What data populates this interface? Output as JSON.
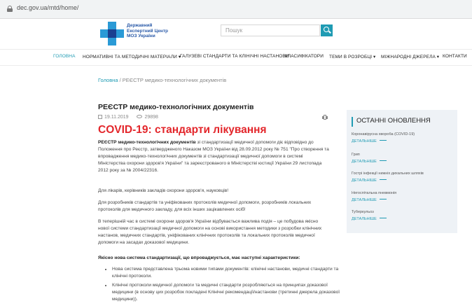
{
  "browser": {
    "url": "dec.gov.ua/mtd/home/"
  },
  "logo": {
    "text": "Державний Експертний Центр МОЗ України"
  },
  "search": {
    "placeholder": "Пошук"
  },
  "nav": {
    "items": [
      "ГОЛОВНА",
      "НОРМАТИВНІ ТА МЕТОДИЧНІ МАТЕРІАЛИ ▾",
      "ГАЛУЗЕВІ СТАНДАРТИ ТА КЛІНІЧНІ НАСТАНОВИ",
      "КЛАСИФІКАТОРИ",
      "ТЕМИ В РОЗРОБЦІ ▾",
      "МІЖНАРОДНІ ДЖЕРЕЛА ▾",
      "КОНТАКТИ"
    ]
  },
  "breadcrumb": {
    "home": "Головна",
    "separator": "/",
    "current": "РЕЄСТР медико-технологічних документів"
  },
  "page": {
    "title": "РЕЄСТР медико-технологічних документів",
    "date": "19.11.2019",
    "views": "29898",
    "headline": "COVID-19: стандарти лікування",
    "p1_bold": "РЕЄСТР медико-технологічних документів",
    "p1_rest": " зі стандартизації медичної допомоги діє відповідно до Положення про Реєстр, затвердженого Наказом МОЗ України від 28.09.2012 року № 751 \"Про створення та впровадження медико-технологічних документів зі стандартизації медичної допомоги в системі Міністерства охорони здоров'я України\" та зареєстрованого в Міністерстві юстиції України 29 листопада 2012 року за № 2004/22316.",
    "p2": "Для лікарів, керівників закладів охорони здоров'я, науковців!",
    "p3": "Для розробників стандартів та уніфікованих протоколів медичної допомоги, розробників локальних протоколів для медичного закладу, для всіх інших зацікавлених осіб!",
    "p4": "В теперішній час в системі охорони здоров'я України відбувається важлива подія – це побудова якісно нової системи стандартизації медичної допомоги на основі використання методики з розробки клінічних настанов, медичних стандартів, уніфікованих клінічних протоколів та локальних протоколів медичної допомоги на засадах доказової медицини.",
    "p5": "Якісно нова система стандартизації, що впроваджується, має наступні характеристики:",
    "bullets": [
      "Нова система представлена трьома новими типами документів: клінічні настанови, медичні стандарти та клінічні протоколи.",
      "Клінічні протоколи медичної допомоги та медичні стандарти розробляються на принципах доказової медицини (в основу цих розробок покладені Клінічні рекомендації/настанови (третинні джерела доказової медицини))."
    ]
  },
  "sidebar": {
    "title": "ОСТАННІ ОНОВЛЕННЯ",
    "more_label": "ДЕТАЛЬНІШЕ",
    "items": [
      "Коронавірусна хвороба (COVID-19)",
      "Грип",
      "Гострі інфекції нижніх дихальних шляхів",
      "Негоспітальна пневмонія",
      "Туберкульоз"
    ]
  },
  "colors": {
    "accent": "#1f9bb3",
    "headline_red": "#e3262b",
    "logo_blue": "#2a9ad6",
    "logo_dark": "#1a3f8f"
  }
}
